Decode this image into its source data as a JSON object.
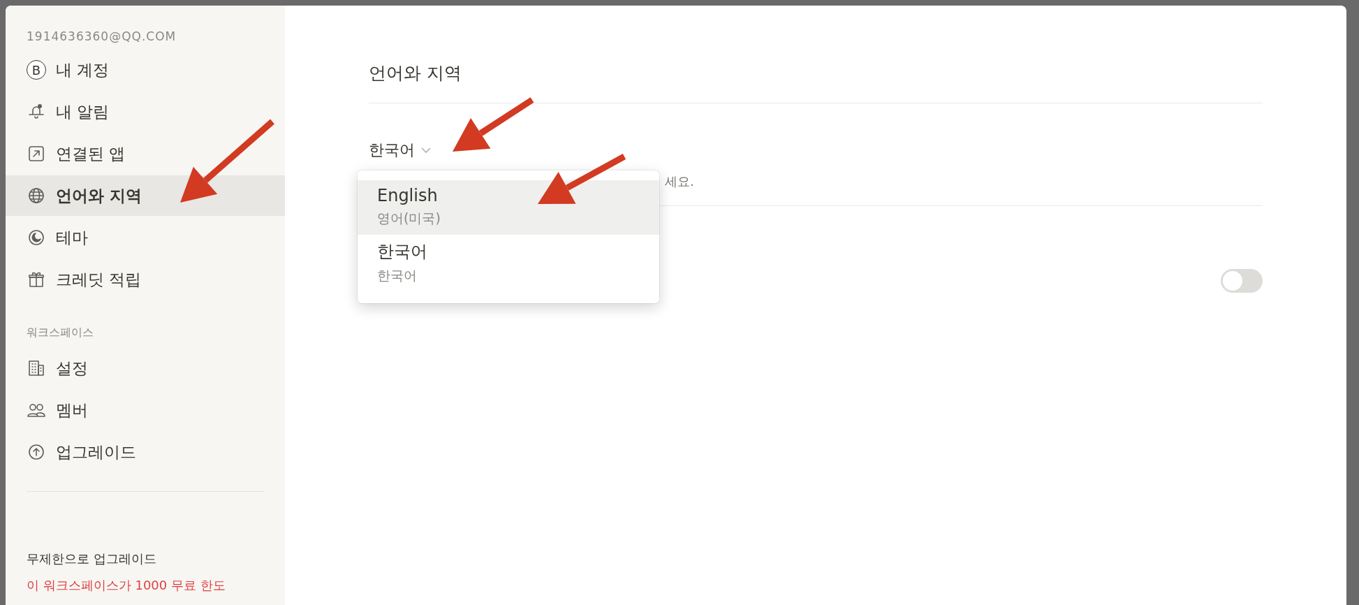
{
  "sidebar": {
    "account_email": "1914636360@QQ.COM",
    "account_items": [
      {
        "label": "내 계정",
        "avatar_letter": "B",
        "selected": false
      },
      {
        "label": "내 알림",
        "selected": false
      },
      {
        "label": "연결된 앱",
        "selected": false
      },
      {
        "label": "언어와 지역",
        "selected": true
      },
      {
        "label": "테마",
        "selected": false
      },
      {
        "label": "크레딧 적립",
        "selected": false
      }
    ],
    "workspace_heading": "워크스페이스",
    "workspace_items": [
      {
        "label": "설정",
        "selected": false
      },
      {
        "label": "멤버",
        "selected": false
      },
      {
        "label": "업그레이드",
        "selected": false
      }
    ],
    "upgrade_title": "무제한으로 업그레이드",
    "upgrade_warning": "이 워크스페이스가 1000 무료 한도"
  },
  "main": {
    "title": "언어와 지역",
    "language_select": {
      "value": "한국어",
      "options": [
        {
          "label": "English",
          "sublabel": "영어(미국)",
          "highlighted": true
        },
        {
          "label": "한국어",
          "sublabel": "한국어",
          "highlighted": false
        }
      ]
    },
    "description_fragment": "세요.",
    "toggle": {
      "on": false
    }
  }
}
